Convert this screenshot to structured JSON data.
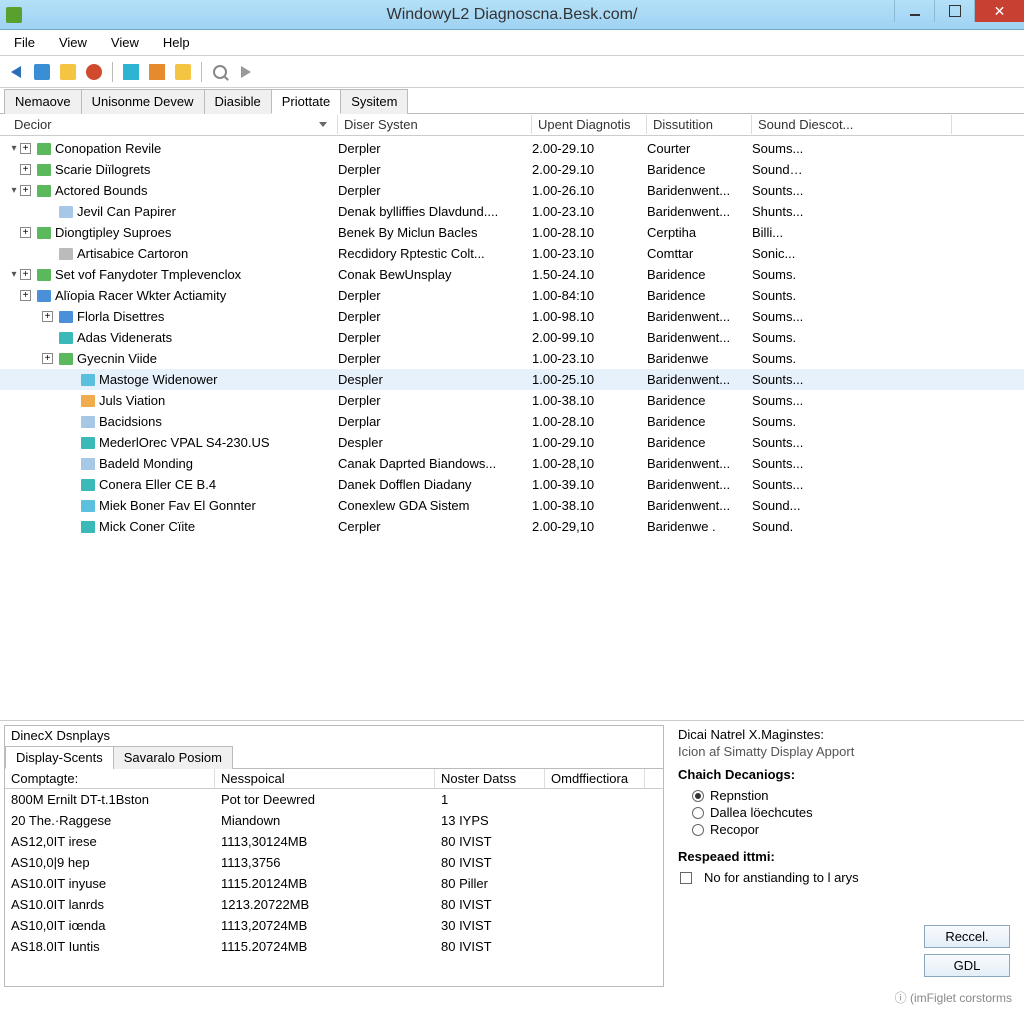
{
  "window": {
    "title": "WindowyL2 Diagnoscna.Besk.com/"
  },
  "menu": [
    "File",
    "View",
    "View",
    "Help"
  ],
  "tabs": {
    "items": [
      "Nemaove",
      "Unisonme Devew",
      "Diasible",
      "Priottate",
      "Sysitem"
    ],
    "active_index": 3
  },
  "columns": [
    "Decior",
    "Diser Systen",
    "Upent Diagnotis",
    "Dissutition",
    "Sound Diescot..."
  ],
  "tree": [
    {
      "indent": 0,
      "arrow": "down",
      "pm": "+",
      "icon": "folder-green",
      "label": "Conopation Revile",
      "c2": "Derpler",
      "c3": "2.00-29.10",
      "c4": "Courter",
      "c5": "Soums..."
    },
    {
      "indent": 0,
      "arrow": "",
      "pm": "+",
      "icon": "folder-green",
      "label": "Scarie Diïlogrets",
      "c2": "Derpler",
      "c3": "2.00-29.10",
      "c4": "Baridence",
      "c5": "Sound…"
    },
    {
      "indent": 0,
      "arrow": "down",
      "pm": "+",
      "icon": "folder-green",
      "label": "Actored Bounds",
      "c2": "Derpler",
      "c3": "1.00-26.10",
      "c4": "Baridenwent...",
      "c5": "Sounts..."
    },
    {
      "indent": 1,
      "arrow": "",
      "pm": "",
      "icon": "folder-doc",
      "label": "Jevil Can Papirer",
      "c2": "Denak bylliffies Dlavdund....",
      "c3": "1.00-23.10",
      "c4": "Baridenwent...",
      "c5": "Shunts..."
    },
    {
      "indent": 0,
      "arrow": "",
      "pm": "+",
      "icon": "folder-green",
      "label": "Diongtipley Suproes",
      "c2": "Benek By Miclun Bacles",
      "c3": "1.00-28.10",
      "c4": "Cerptiha",
      "c5": "Billi..."
    },
    {
      "indent": 1,
      "arrow": "",
      "pm": "",
      "icon": "folder-gray",
      "label": "Artisabice Cartoron",
      "c2": "Recdidory Rptestic Colt...",
      "c3": "1.00-23.10",
      "c4": "Comttar",
      "c5": "Sonic..."
    },
    {
      "indent": 0,
      "arrow": "down",
      "pm": "+",
      "icon": "folder-green",
      "label": "Set vof Fanydoter Tmplevenclox",
      "c2": "Conak BewUnsplay",
      "c3": "1.50-24.10",
      "c4": "Baridence",
      "c5": "Soums."
    },
    {
      "indent": 0,
      "arrow": "",
      "pm": "+",
      "icon": "folder-blue",
      "label": "Alïopia Racer Wkter Actiamity",
      "c2": "Derpler",
      "c3": "1.00-84:10",
      "c4": "Baridence",
      "c5": "Sounts."
    },
    {
      "indent": 1,
      "arrow": "",
      "pm": "+",
      "icon": "folder-blue",
      "label": "Florla Disettres",
      "c2": "Derpler",
      "c3": "1.00-98.10",
      "c4": "Baridenwent...",
      "c5": "Soums..."
    },
    {
      "indent": 1,
      "arrow": "",
      "pm": "",
      "icon": "folder-teal",
      "label": "Adas Videnerats",
      "c2": "Derpler",
      "c3": "2.00-99.10",
      "c4": "Baridenwent...",
      "c5": "Soums."
    },
    {
      "indent": 1,
      "arrow": "",
      "pm": "+",
      "icon": "folder-green",
      "label": "Gyecnin Viide",
      "c2": "Derpler",
      "c3": "1.00-23.10",
      "c4": "Baridenwe",
      "c5": "Soums."
    },
    {
      "indent": 2,
      "arrow": "",
      "pm": "",
      "icon": "folder-cyan",
      "label": "Mastoge Widenower",
      "c2": "Despler",
      "c3": "1.00-25.10",
      "c4": "Baridenwent...",
      "c5": "Sounts...",
      "selected": true
    },
    {
      "indent": 2,
      "arrow": "",
      "pm": "",
      "icon": "folder-yellow",
      "label": "Juls Viation",
      "c2": "Derpler",
      "c3": "1.00-38.10",
      "c4": "Baridence",
      "c5": "Soums..."
    },
    {
      "indent": 2,
      "arrow": "",
      "pm": "",
      "icon": "folder-doc",
      "label": "Bacidsions",
      "c2": "Derplar",
      "c3": "1.00-28.10",
      "c4": "Baridence",
      "c5": "Soums."
    },
    {
      "indent": 2,
      "arrow": "",
      "pm": "",
      "icon": "folder-teal",
      "label": "MederlOrec VPAL S4-230.US",
      "c2": "Despler",
      "c3": "1.00-29.10",
      "c4": "Baridence",
      "c5": "Sounts..."
    },
    {
      "indent": 2,
      "arrow": "",
      "pm": "",
      "icon": "folder-doc",
      "label": "Badeld Monding",
      "c2": "Canak Daprted Biandows...",
      "c3": "1.00-28,10",
      "c4": "Baridenwent...",
      "c5": "Sounts..."
    },
    {
      "indent": 2,
      "arrow": "",
      "pm": "",
      "icon": "folder-teal",
      "label": "Conera Eller CE B.4",
      "c2": "Danek Dofflen Diadany",
      "c3": "1.00-39.10",
      "c4": "Baridenwent...",
      "c5": "Sounts..."
    },
    {
      "indent": 2,
      "arrow": "",
      "pm": "",
      "icon": "folder-cyan",
      "label": "Miek Boner Fav El Gonnter",
      "c2": "Conexlew GDA Sistem",
      "c3": "1.00-38.10",
      "c4": "Baridenwent...",
      "c5": "Sound..."
    },
    {
      "indent": 2,
      "arrow": "",
      "pm": "",
      "icon": "folder-teal",
      "label": "Mick Coner Cïite",
      "c2": "Cerpler",
      "c3": "2.00-29,10",
      "c4": "Baridenwe .",
      "c5": "Sound."
    }
  ],
  "bottom_left": {
    "title": "DinecX Dsnplays",
    "tabs": [
      "Display-Scents",
      "Savaralo Posiom"
    ],
    "active_tab": 0,
    "columns": [
      "Comptagte:",
      "Nesspoical",
      "Noster Datss",
      "Omdffiectiora"
    ],
    "rows": [
      {
        "c1": "800M Ernilt DT-t.1Bston",
        "c2": "Pot tor Deewred",
        "c3": "1",
        "c4": ""
      },
      {
        "c1": "20 The.·Raggese",
        "c2": "Miandown",
        "c3": "13 IYPS",
        "c4": ""
      },
      {
        "c1": "AS12,0IT irese",
        "c2": "1113,30124MB",
        "c3": "80 IVIST",
        "c4": ""
      },
      {
        "c1": "AS10,0|9 hep",
        "c2": "1113,3756",
        "c3": "80 IVIST",
        "c4": ""
      },
      {
        "c1": "AS10.0IT inyuse",
        "c2": "1115.20124MB",
        "c3": "80 Piller",
        "c4": ""
      },
      {
        "c1": "AS10.0IT lanrds",
        "c2": "1213.20722MB",
        "c3": "80 IVIST",
        "c4": ""
      },
      {
        "c1": "AS10,0IT iœnda",
        "c2": "1113,20724MB",
        "c3": "30 IVIST",
        "c4": ""
      },
      {
        "c1": "AS18.0IT Iuntis",
        "c2": "1115.20724MB",
        "c3": "80 IVIST",
        "c4": ""
      }
    ]
  },
  "bottom_right": {
    "title": "Dicai Natrel X.Maginstes:",
    "subtitle": "Icion af Simatty Display Apport",
    "group_title": "Chaich Decaniogs:",
    "radios": [
      "Repnstion",
      "Dallea löechcutes",
      "Recopor"
    ],
    "radio_selected": 0,
    "respeated_label": "Respeaed ittmi:",
    "checkbox_label": "No for anstianding to l arys",
    "buttons": [
      "Reccel.",
      "GDL"
    ],
    "footer": "(imFiglet corstorms"
  }
}
